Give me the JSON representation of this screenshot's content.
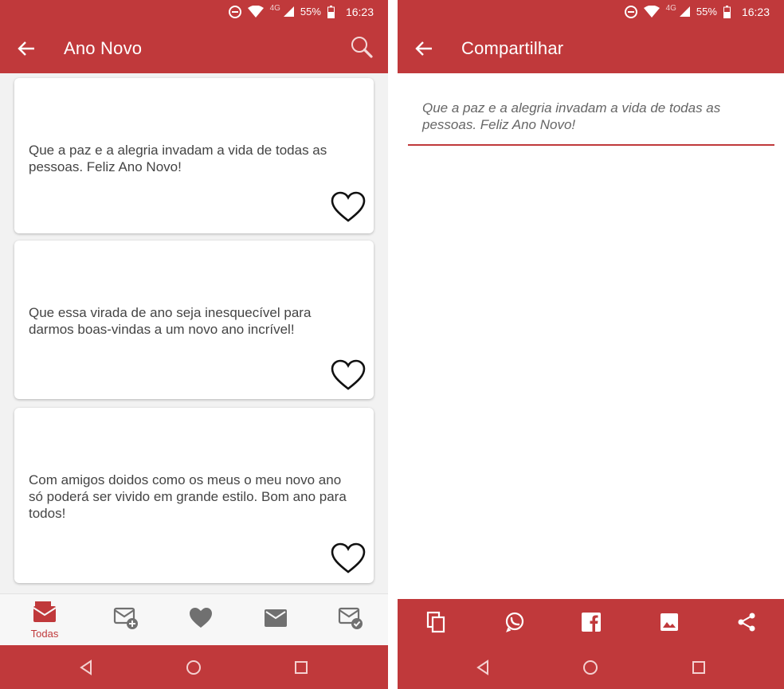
{
  "status_bar": {
    "network": "4G",
    "battery": "55%",
    "time": "16:23"
  },
  "left_screen": {
    "title": "Ano Novo",
    "cards": [
      {
        "text_lines": [
          "Que a paz e a alegria invadam a vida de todas as",
          "pessoas. Feliz Ano Novo!"
        ]
      },
      {
        "text_lines": [
          "Que essa virada de ano seja inesquecível para",
          "darmos boas-vindas a um novo ano incrível!"
        ]
      },
      {
        "text_lines": [
          "Com amigos doidos como os meus o meu novo ano",
          "só poderá ser vivido em grande estilo. Bom ano para",
          "todos!"
        ]
      }
    ],
    "bottom_nav": {
      "active_label": "Todas",
      "items": [
        "all-messages-icon",
        "new-message-icon",
        "favorites-heart-icon",
        "messages-icon",
        "sent-messages-icon"
      ]
    }
  },
  "right_screen": {
    "title": "Compartilhar",
    "message_lines": [
      "Que a paz e a alegria invadam a vida de todas as",
      "pessoas. Feliz Ano Novo!"
    ],
    "share_actions": [
      "copy-icon",
      "whatsapp-icon",
      "facebook-icon",
      "image-icon",
      "share-icon"
    ]
  },
  "colors": {
    "accent": "#c0393b",
    "card_text": "#444444",
    "nav_inactive": "#707070"
  }
}
